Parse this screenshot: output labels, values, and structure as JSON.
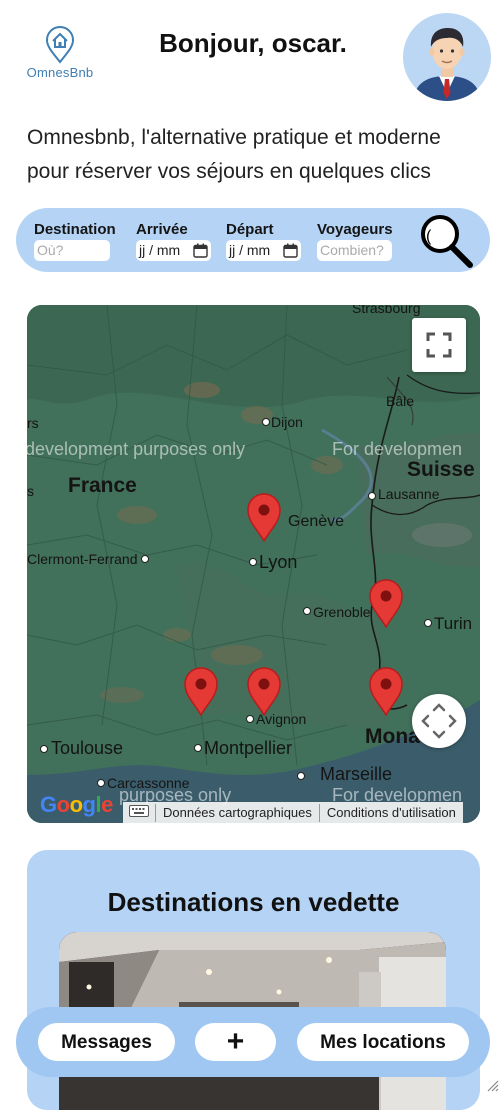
{
  "header": {
    "logo_text": "OmnesBnb",
    "greeting": "Bonjour, oscar.",
    "avatar_icon": "user-avatar-icon"
  },
  "tagline": "Omnesbnb, l'alternative pratique et moderne pour réserver vos séjours en quelques clics",
  "search": {
    "destination_label": "Destination",
    "destination_placeholder": "Où?",
    "arrival_label": "Arrivée",
    "arrival_value": "jj / mm",
    "departure_label": "Départ",
    "departure_value": "jj / mm",
    "travelers_label": "Voyageurs",
    "travelers_placeholder": "Combien?",
    "button_icon": "search-icon"
  },
  "map": {
    "labels": {
      "strasbourg": "Strasbourg",
      "dijon": "Dijon",
      "bale": "Bâle",
      "suisse": "Suisse",
      "france": "France",
      "lausanne": "Lausanne",
      "geneve": "Genève",
      "clermont": "Clermont-Ferrand",
      "lyon": "Lyon",
      "grenoble": "Grenoble",
      "turin": "Turin",
      "avignon": "Avignon",
      "toulouse": "Toulouse",
      "montpellier": "Montpellier",
      "marseille": "Marseille",
      "carcassonne": "Carcassonne",
      "monaco": "Mona",
      "rs": "rs",
      "s": "s"
    },
    "watermark": "For development purposes only",
    "watermark_left_top": "development purposes only",
    "watermark_right_top": "For developmen",
    "watermark_left_bottom": "purposes only",
    "watermark_right_bottom": "For developmen",
    "google": "Google",
    "attribution_data": "Données cartographiques",
    "attribution_terms": "Conditions d'utilisation",
    "keyboard_icon": "keyboard-icon",
    "fullscreen_icon": "fullscreen-icon",
    "pan_icon": "pan-control-icon",
    "pin_icon": "map-pin-icon"
  },
  "featured": {
    "title": "Destinations en vedette"
  },
  "bottom_nav": {
    "messages": "Messages",
    "add": "+",
    "my_rentals": "Mes locations"
  },
  "colors": {
    "accent": "#b5d3f5",
    "bottom_bar": "#9fc7f2",
    "pin": "#e53935",
    "logo": "#3f7fb3",
    "map_bg": "#3f6b58"
  }
}
